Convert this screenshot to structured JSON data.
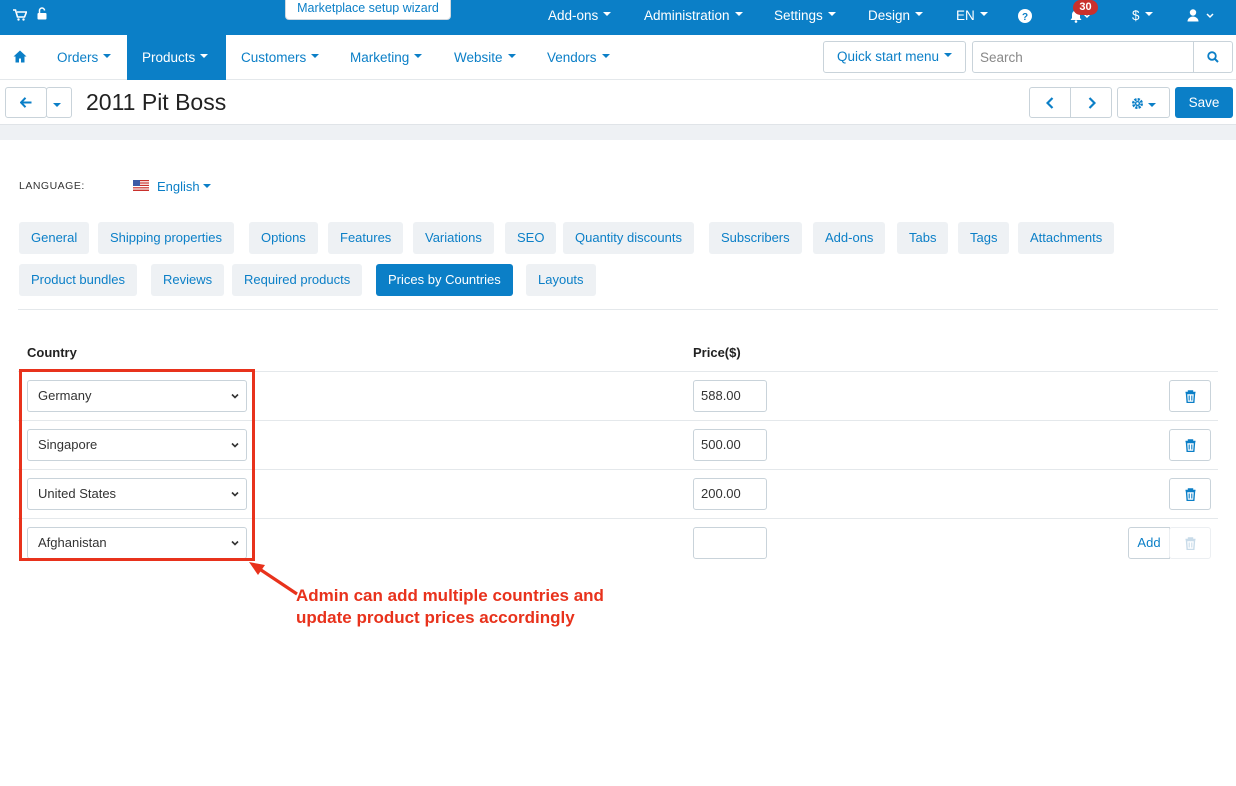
{
  "topbar": {
    "wizard_label": "Marketplace setup wizard",
    "items": [
      {
        "label": "Add-ons"
      },
      {
        "label": "Administration"
      },
      {
        "label": "Settings"
      },
      {
        "label": "Design"
      },
      {
        "label": "EN"
      }
    ],
    "notification_count": "30",
    "currency": "$",
    "icons": [
      "cart-icon",
      "unlock-icon",
      "help-icon",
      "bell-icon",
      "user-icon"
    ]
  },
  "mainnav": {
    "items": [
      {
        "label": "Orders"
      },
      {
        "label": "Products"
      },
      {
        "label": "Customers"
      },
      {
        "label": "Marketing"
      },
      {
        "label": "Website"
      },
      {
        "label": "Vendors"
      }
    ],
    "quick_start_label": "Quick start menu",
    "search_placeholder": "Search"
  },
  "titlebar": {
    "title": "2011 Pit Boss",
    "save_label": "Save"
  },
  "language": {
    "label": "LANGUAGE:",
    "value": "English"
  },
  "tabs": [
    "General",
    "Shipping properties",
    "Options",
    "Features",
    "Variations",
    "SEO",
    "Quantity discounts",
    "Subscribers",
    "Add-ons",
    "Tabs",
    "Tags",
    "Attachments",
    "Product bundles",
    "Reviews",
    "Required products",
    "Prices by Countries",
    "Layouts"
  ],
  "active_tab": "Prices by Countries",
  "table": {
    "headers": {
      "country": "Country",
      "price": "Price($)"
    },
    "rows": [
      {
        "country": "Germany",
        "price": "588.00"
      },
      {
        "country": "Singapore",
        "price": "500.00"
      },
      {
        "country": "United States",
        "price": "200.00"
      }
    ],
    "new_row": {
      "country": "Afghanistan",
      "price": ""
    },
    "add_label": "Add"
  },
  "annotation": {
    "line1": "Admin can add multiple countries and",
    "line2": "update product prices accordingly",
    "color": "#e8321c"
  },
  "colors": {
    "accent": "#0b7fc7",
    "badge": "#c9302c"
  }
}
